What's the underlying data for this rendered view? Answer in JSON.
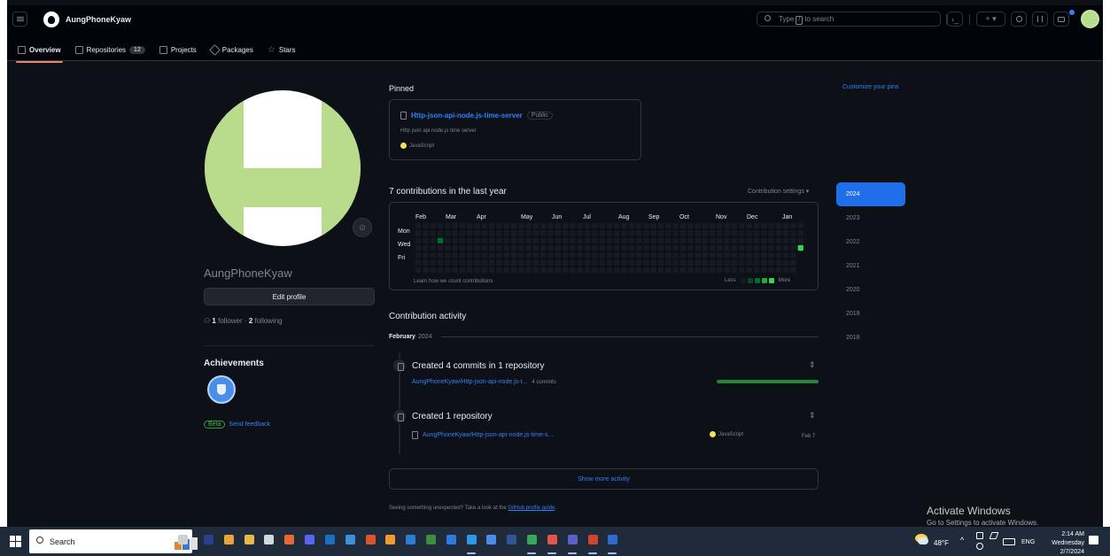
{
  "header": {
    "username": "AungPhoneKyaw",
    "search": {
      "prefix": "Type",
      "key": "/",
      "suffix": "to search"
    },
    "buttons": {
      "terminal": "›_",
      "create": "+ ▾"
    }
  },
  "nav": {
    "tabs": [
      {
        "label": "Overview"
      },
      {
        "label": "Repositories",
        "count": "12"
      },
      {
        "label": "Projects"
      },
      {
        "label": "Packages"
      },
      {
        "label": "Stars"
      }
    ]
  },
  "profile": {
    "name": "AungPhoneKyaw",
    "edit_label": "Edit profile",
    "followers_count": "1",
    "followers_label": "follower",
    "sep": "·",
    "following_count": "2",
    "following_label": "following",
    "achievements_title": "Achievements",
    "beta_label": "Beta",
    "feedback_label": "Send feedback"
  },
  "pinned": {
    "title": "Pinned",
    "customize_label": "Customize your pins",
    "repo": {
      "name": "Http-json-api-node.js-time-server",
      "visibility": "Public",
      "description": "Http json api node.js time server",
      "language": "JavaScript",
      "language_color": "#f1e05a"
    }
  },
  "contributions": {
    "title": "7 contributions in the last year",
    "settings_label": "Contribution settings ▾",
    "months": [
      "Feb",
      "Mar",
      "Apr",
      "May",
      "Jun",
      "Jul",
      "Aug",
      "Sep",
      "Oct",
      "Nov",
      "Dec",
      "Jan"
    ],
    "days": [
      "Mon",
      "Wed",
      "Fri"
    ],
    "learn_label": "Learn how we count contributions",
    "legend_less": "Less",
    "legend_more": "More",
    "colors": {
      "empty": "#161b22",
      "l1": "#0e4429",
      "l2": "#006d32",
      "l3": "#26a641",
      "l4": "#39d353"
    },
    "active_cells": [
      {
        "week": 3,
        "day": 2,
        "level": 2
      },
      {
        "week": 52,
        "day": 3,
        "level": 4
      }
    ]
  },
  "years": [
    "2024",
    "2023",
    "2022",
    "2021",
    "2020",
    "2019",
    "2018"
  ],
  "activity": {
    "title": "Contribution activity",
    "month": "February",
    "year": "2024",
    "items": [
      {
        "heading": "Created 4 commits in 1 repository",
        "repo": "AungPhoneKyaw/Http-json-api-node.js-t...",
        "meta": "4 commits"
      },
      {
        "heading": "Created 1 repository",
        "repo": "AungPhoneKyaw/Http-json-api-node.js-time-s...",
        "language": "JavaScript",
        "date": "Feb 7"
      }
    ],
    "show_more_label": "Show more activity",
    "unexpected_prefix": "Seeing something unexpected? Take a look at the",
    "unexpected_link": "GitHub profile guide",
    "unexpected_suffix": "."
  },
  "watermark": {
    "title": "Activate Windows",
    "subtitle": "Go to Settings to activate Windows."
  },
  "taskbar": {
    "search_label": "Search",
    "weather_temp": "48°F",
    "caret": "^",
    "language": "ENG",
    "time": "2:14 AM",
    "day": "Wednesday",
    "date": "2/7/2024"
  }
}
